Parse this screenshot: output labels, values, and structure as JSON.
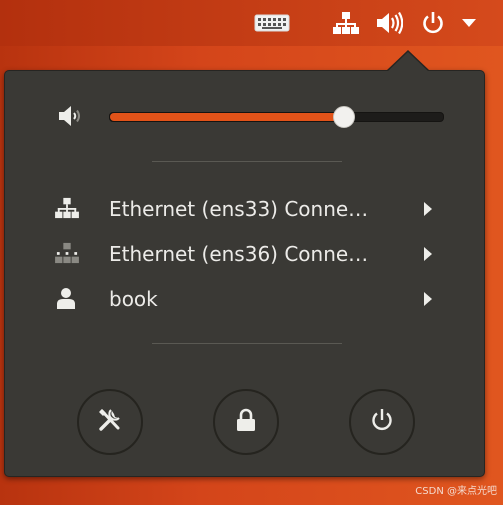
{
  "topbar": {
    "icons": [
      "keyboard-icon",
      "network-wired-icon",
      "volume-icon",
      "power-icon",
      "dropdown-arrow-icon"
    ]
  },
  "menu": {
    "volume": {
      "level": 0.7,
      "icon": "speaker-low-icon"
    },
    "items": [
      {
        "label": "Ethernet (ens33) Conne…",
        "icon": "network-wired-icon",
        "state": "connected"
      },
      {
        "label": "Ethernet (ens36) Conne…",
        "icon": "network-wired-dim-icon",
        "state": "connecting"
      },
      {
        "label": "book",
        "icon": "user-icon"
      }
    ],
    "buttons": [
      "settings-button",
      "lock-button",
      "power-off-button"
    ]
  },
  "colors": {
    "accent": "#e25319",
    "menu_bg": "#3a3935",
    "text": "#ecebe8"
  },
  "watermark": "CSDN @来点光吧"
}
